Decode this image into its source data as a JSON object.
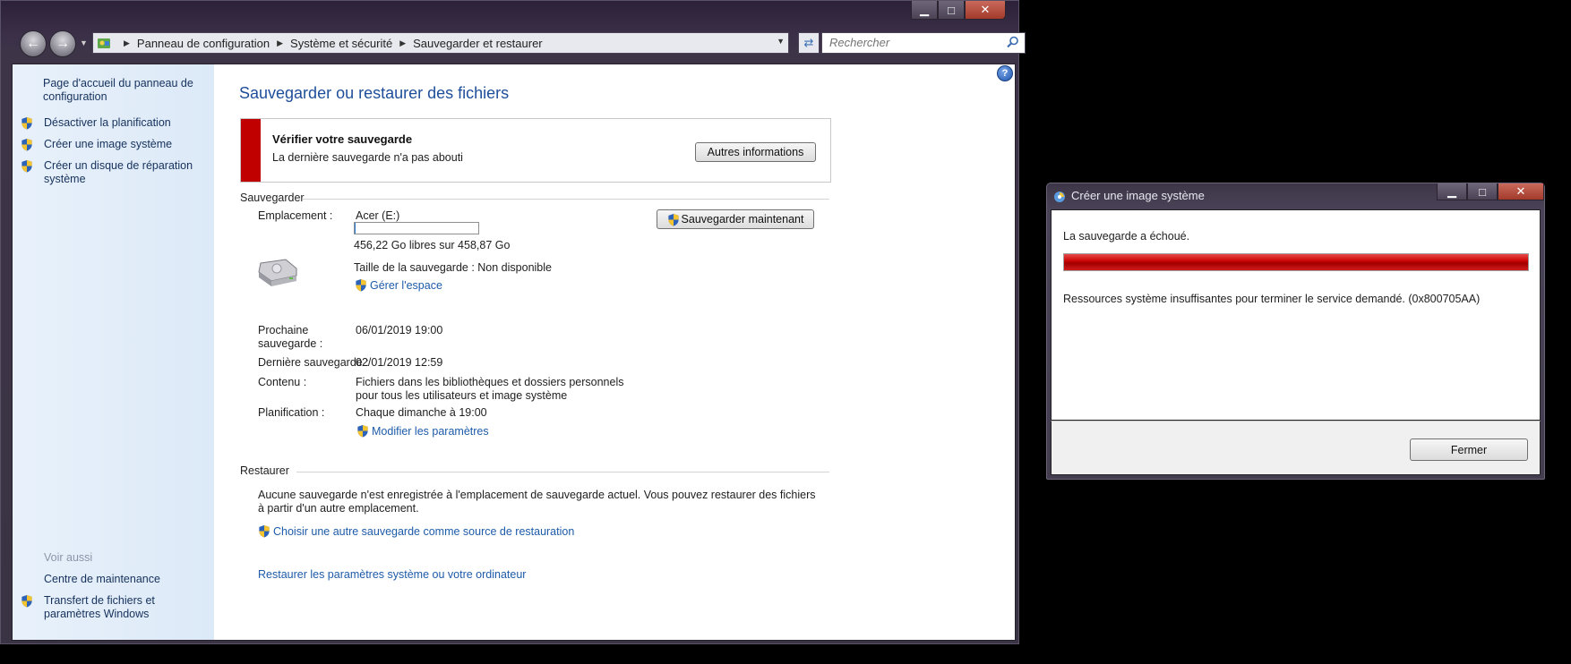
{
  "explorer": {
    "window_buttons": {
      "minimize": "▁",
      "maximize": "□",
      "close": "✕"
    },
    "breadcrumb": [
      "Panneau de configuration",
      "Système et sécurité",
      "Sauvegarder et restaurer"
    ],
    "search_placeholder": "Rechercher",
    "sidebar": {
      "home": "Page d'accueil du panneau de configuration",
      "items": [
        "Désactiver la planification",
        "Créer une image système",
        "Créer un disque de réparation système"
      ],
      "see_also_title": "Voir aussi",
      "see_also": [
        "Centre de maintenance",
        "Transfert de fichiers et paramètres Windows"
      ]
    },
    "main": {
      "title": "Sauvegarder ou restaurer des fichiers",
      "alert": {
        "title": "Vérifier votre sauvegarde",
        "text": "La dernière sauvegarde n'a pas abouti",
        "button": "Autres informations"
      },
      "backup": {
        "section": "Sauvegarder",
        "location_label": "Emplacement :",
        "location_value": "Acer (E:)",
        "space_used_fraction": 0.006,
        "free_space": "456,22 Go libres sur 458,87 Go",
        "backup_size": "Taille de la sauvegarde : Non disponible",
        "manage_space": "Gérer l'espace",
        "backup_now": "Sauvegarder maintenant",
        "next_label": "Prochaine sauvegarde :",
        "next_value": "06/01/2019 19:00",
        "last_label": "Dernière sauvegarde :",
        "last_value": "02/01/2019 12:59",
        "contents_label": "Contenu :",
        "contents_value": "Fichiers dans les bibliothèques et dossiers personnels pour tous les utilisateurs et image système",
        "schedule_label": "Planification :",
        "schedule_value": "Chaque dimanche à 19:00",
        "change_settings": "Modifier les paramètres"
      },
      "restore": {
        "section": "Restaurer",
        "text": "Aucune sauvegarde n'est enregistrée à l'emplacement de sauvegarde actuel. Vous pouvez restaurer des fichiers à partir d'un autre emplacement.",
        "choose_link": "Choisir une autre sauvegarde comme source de restauration",
        "system_link": "Restaurer les paramètres système ou votre ordinateur"
      }
    }
  },
  "dialog": {
    "title": "Créer une image système",
    "window_buttons": {
      "minimize": "▁",
      "maximize": "□",
      "close": "✕"
    },
    "status": "La sauvegarde a échoué.",
    "progress_fraction": 1.0,
    "error": "Ressources système insuffisantes pour terminer le service demandé. (0x800705AA)",
    "close_button": "Fermer"
  },
  "colors": {
    "error_red": "#c00000",
    "link_blue": "#1d5ba8",
    "title_blue": "#1e4e9a"
  }
}
